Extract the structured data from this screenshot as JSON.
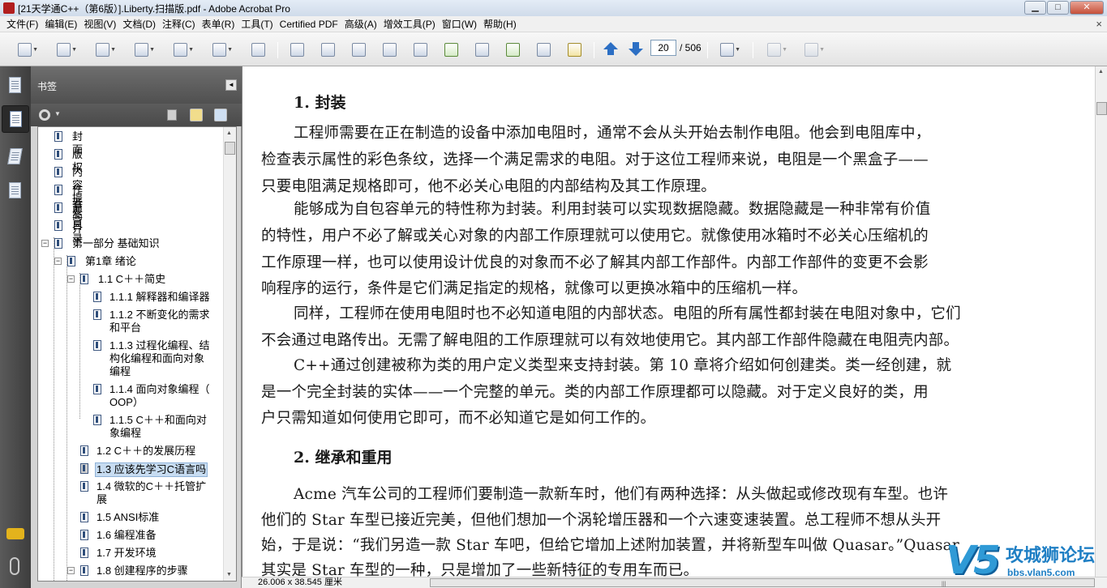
{
  "window": {
    "title": "[21天学通C++（第6版）].Liberty.扫描版.pdf - Adobe Acrobat Pro",
    "min_glyph": "▁",
    "max_glyph": "□",
    "close_glyph": "✕"
  },
  "menu": [
    "文件(F)",
    "编辑(E)",
    "视图(V)",
    "文档(D)",
    "注释(C)",
    "表单(R)",
    "工具(T)",
    "Certified PDF",
    "高级(A)",
    "增效工具(P)",
    "窗口(W)",
    "帮助(H)"
  ],
  "menu_close_glyph": "×",
  "toolbar": {
    "current_page": "20",
    "total_pages": "/ 506",
    "dropdown_glyph": "▼"
  },
  "bookmarks": {
    "title": "书签",
    "collapse_glyph": "◄",
    "scroll_up": "▲",
    "scroll_down": "▼",
    "items": [
      {
        "label": "封面",
        "toggle": ""
      },
      {
        "label": "版权",
        "toggle": ""
      },
      {
        "label": "内容提要",
        "toggle": ""
      },
      {
        "label": "作者简介",
        "toggle": ""
      },
      {
        "label": "前言",
        "toggle": ""
      },
      {
        "label": "目录",
        "toggle": ""
      },
      {
        "label": "第一部分 基础知识",
        "toggle": "−"
      },
      {
        "label": "第1章 绪论",
        "toggle": "−"
      },
      {
        "label": "1.1 C＋＋简史",
        "toggle": "−"
      },
      {
        "label": "1.1.1 解释器和编译器",
        "toggle": ""
      },
      {
        "label": "1.1.2 不断变化的需求\n和平台",
        "toggle": ""
      },
      {
        "label": "1.1.3 过程化编程、结\n构化编程和面向对象\n编程",
        "toggle": ""
      },
      {
        "label": "1.1.4 面向对象编程（\nOOP）",
        "toggle": ""
      },
      {
        "label": "1.1.5 C＋＋和面向对\n象编程",
        "toggle": ""
      },
      {
        "label": "1.2 C＋＋的发展历程",
        "toggle": ""
      },
      {
        "label": "1.3 应该先学习C语言吗",
        "toggle": ""
      },
      {
        "label": "1.4 微软的C＋＋托管扩\n展",
        "toggle": ""
      },
      {
        "label": "1.5 ANSI标准",
        "toggle": ""
      },
      {
        "label": "1.6 编程准备",
        "toggle": ""
      },
      {
        "label": "1.7 开发环境",
        "toggle": ""
      },
      {
        "label": "1.8 创建程序的步骤",
        "toggle": "−"
      }
    ]
  },
  "document": {
    "heading1": "1.  封装",
    "p1_l1": "工程师需要在正在制造的设备中添加电阻时，通常不会从头开始去制作电阻。他会到电阻库中，",
    "p1_l2": "检查表示属性的彩色条纹，选择一个满足需求的电阻。对于这位工程师来说，电阻是一个黑盒子——",
    "p1_l3": "只要电阻满足规格即可，他不必关心电阻的内部结构及其工作原理。",
    "p2_l1": "能够成为自包容单元的特性称为封装。利用封装可以实现数据隐藏。数据隐藏是一种非常有价值",
    "p2_l2": "的特性，用户不必了解或关心对象的内部工作原理就可以使用它。就像使用冰箱时不必关心压缩机的",
    "p2_l3": "工作原理一样，也可以使用设计优良的对象而不必了解其内部工作部件。内部工作部件的变更不会影",
    "p2_l4": "响程序的运行，条件是它们满足指定的规格，就像可以更换冰箱中的压缩机一样。",
    "p3_l1": "同样，工程师在使用电阻时也不必知道电阻的内部状态。电阻的所有属性都封装在电阻对象中，它们",
    "p3_l2": "不会通过电路传出。无需了解电阻的工作原理就可以有效地使用它。其内部工作部件隐藏在电阻壳内部。",
    "p4_l1": "C++通过创建被称为类的用户定义类型来支持封装。第 10 章将介绍如何创建类。类一经创建，就",
    "p4_l2": "是一个完全封装的实体——一个完整的单元。类的内部工作原理都可以隐藏。对于定义良好的类，用",
    "p4_l3": "户只需知道如何使用它即可，而不必知道它是如何工作的。",
    "heading2": "2.  继承和重用",
    "p5_l1": "Acme 汽车公司的工程师们要制造一款新车时，他们有两种选择：从头做起或修改现有车型。也许",
    "p5_l2": "他们的 Star 车型已接近完美，但他们想加一个涡轮增压器和一个六速变速装置。总工程师不想从头开",
    "p5_l3": "始，于是说：“我们另造一款 Star 车吧，但给它增加上述附加装置，并将新型车叫做 Quasar。”Quasar",
    "p5_l4": "其实是 Star 车型的一种，只是增加了一些新特征的专用车而已。"
  },
  "status": {
    "page_size": "26.006 x 38.545 厘米",
    "grip": "|||"
  },
  "watermark": {
    "logo": "V5",
    "name": "攻城狮论坛",
    "url": "bbs.vlan5.com"
  },
  "colors": {
    "panel_dark": "#505050",
    "selection": "#c7dcf1",
    "nav_arrow": "#2c6fc4",
    "watermark": "#1f7fc4"
  }
}
